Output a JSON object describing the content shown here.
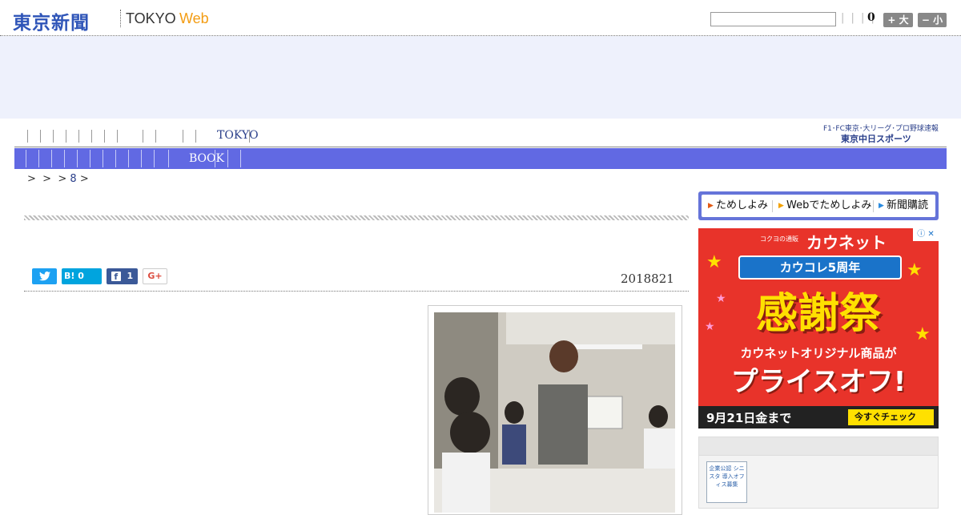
{
  "header": {
    "logo_text": "東京新聞",
    "logo_tokyo": "TOKYO",
    "logo_web": "Web",
    "search_value": "",
    "pipes": "| | | |",
    "count": "0",
    "font_big_label": "+ 大",
    "font_small_label": "− 小"
  },
  "nav": {
    "primary_label": "TOKYO",
    "secondary_label": "BOOK",
    "chunichi_tagline": "F1･FC東京･大リーグ･プロ野球速報",
    "chunichi_logo": "東京中日スポーツ"
  },
  "breadcrumb": {
    "sep1": ">",
    "sep2": ">",
    "sep3": ">",
    "item": "8",
    "sep4": ">"
  },
  "article": {
    "date": "2018821",
    "share": {
      "hatena_label": "B! 0",
      "facebook_count": "1",
      "gplus_label": "G+"
    }
  },
  "sidebar": {
    "trial_links": [
      "ためしよみ",
      "Webでためしよみ",
      "新聞購読"
    ],
    "ad": {
      "brand_small": "コクヨの通販",
      "brand": "カウネット",
      "ribbon": "カウコレ5周年",
      "headline": "感謝祭",
      "line2": "カウネットオリジナル商品が",
      "line3": "プライスオフ!",
      "date_text": "9月21日金まで",
      "cta": "今すぐチェック",
      "info": "ⓘ ✕"
    },
    "box_badge": "企業公認 シニスタ 導入オフィス募集"
  },
  "colors": {
    "brand_blue": "#2f55b8",
    "nav_blue": "#6169e3",
    "ad_band": "#eef1fc",
    "web_orange": "#f39c12"
  }
}
